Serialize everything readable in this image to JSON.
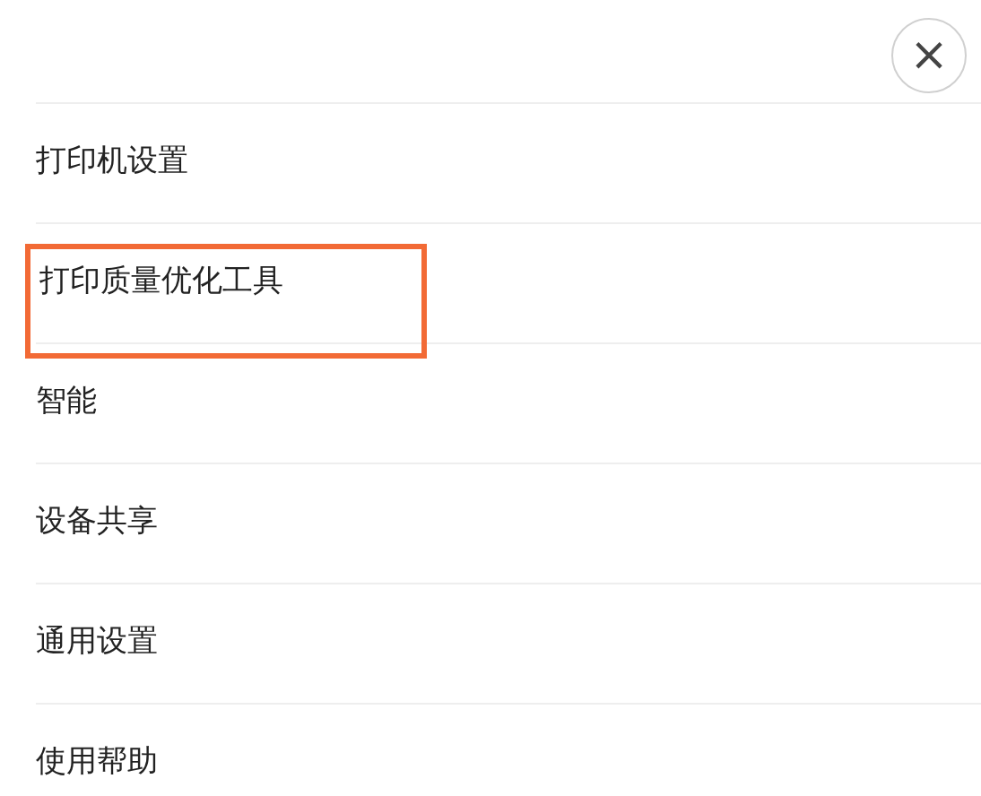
{
  "close_button": {
    "label": "×"
  },
  "menu": [
    {
      "label": "打印机设置",
      "highlighted": false
    },
    {
      "label": "打印质量优化工具",
      "highlighted": true
    },
    {
      "label": "智能",
      "highlighted": false
    },
    {
      "label": "设备共享",
      "highlighted": false
    },
    {
      "label": "通用设置",
      "highlighted": false
    },
    {
      "label": "使用帮助",
      "highlighted": false
    }
  ]
}
